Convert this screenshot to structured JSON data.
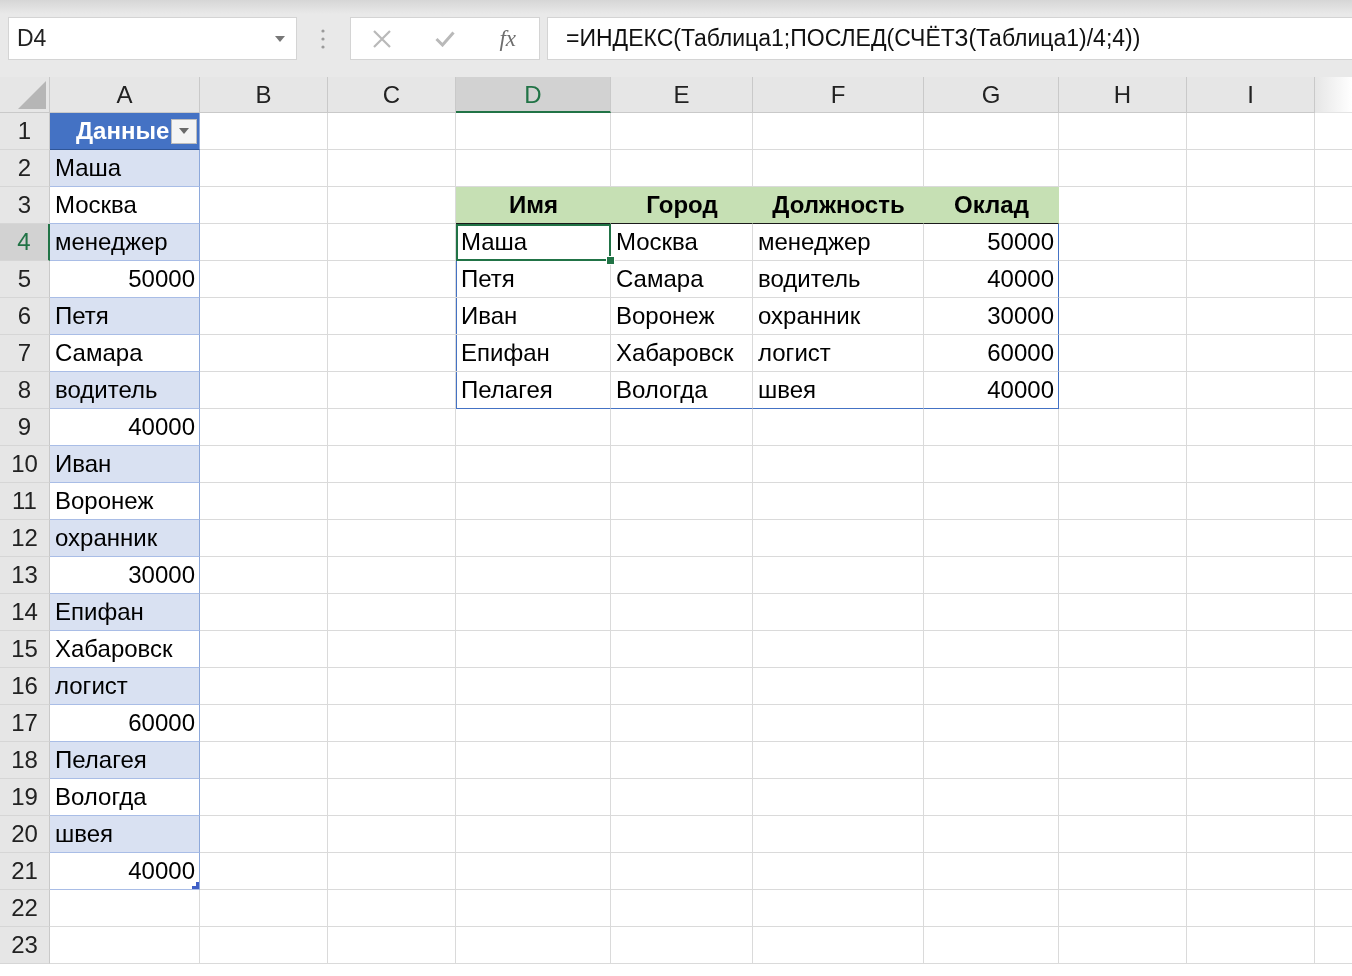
{
  "name_box": {
    "value": "D4"
  },
  "formula_bar": {
    "buttons": [
      {
        "kind": "cancel",
        "disabled": true
      },
      {
        "kind": "enter",
        "disabled": true
      },
      {
        "kind": "function",
        "label": "fx",
        "disabled": false
      }
    ],
    "value": "=ИНДЕКС(Таблица1;ПОСЛЕД(СЧЁТЗ(Таблица1)/4;4))"
  },
  "columns": [
    {
      "label": "A",
      "selected": false
    },
    {
      "label": "B",
      "selected": false
    },
    {
      "label": "C",
      "selected": false
    },
    {
      "label": "D",
      "selected": true
    },
    {
      "label": "E",
      "selected": false
    },
    {
      "label": "F",
      "selected": false
    },
    {
      "label": "G",
      "selected": false
    },
    {
      "label": "H",
      "selected": false
    },
    {
      "label": "I",
      "selected": false
    }
  ],
  "rows": [
    {
      "label": "1",
      "selected": false
    },
    {
      "label": "2",
      "selected": false
    },
    {
      "label": "3",
      "selected": false
    },
    {
      "label": "4",
      "selected": true
    },
    {
      "label": "5",
      "selected": false
    },
    {
      "label": "6",
      "selected": false
    },
    {
      "label": "7",
      "selected": false
    },
    {
      "label": "8",
      "selected": false
    },
    {
      "label": "9",
      "selected": false
    },
    {
      "label": "10",
      "selected": false
    },
    {
      "label": "11",
      "selected": false
    },
    {
      "label": "12",
      "selected": false
    },
    {
      "label": "13",
      "selected": false
    },
    {
      "label": "14",
      "selected": false
    },
    {
      "label": "15",
      "selected": false
    },
    {
      "label": "16",
      "selected": false
    },
    {
      "label": "17",
      "selected": false
    },
    {
      "label": "18",
      "selected": false
    },
    {
      "label": "19",
      "selected": false
    },
    {
      "label": "20",
      "selected": false
    },
    {
      "label": "21",
      "selected": false
    },
    {
      "label": "22",
      "selected": false
    },
    {
      "label": "23",
      "selected": false
    }
  ],
  "data_table": {
    "header": "Данные",
    "cells": [
      {
        "text": "Маша",
        "kind": "text",
        "selected": false
      },
      {
        "text": "Москва",
        "kind": "text",
        "selected": false
      },
      {
        "text": "менеджер",
        "kind": "text",
        "selected": false
      },
      {
        "text": "50000",
        "kind": "number",
        "selected": false
      },
      {
        "text": "Петя",
        "kind": "text",
        "selected": false
      },
      {
        "text": "Самара",
        "kind": "text",
        "selected": false
      },
      {
        "text": "водитель",
        "kind": "text",
        "selected": false
      },
      {
        "text": "40000",
        "kind": "number",
        "selected": false
      },
      {
        "text": "Иван",
        "kind": "text",
        "selected": false
      },
      {
        "text": "Воронеж",
        "kind": "text",
        "selected": false
      },
      {
        "text": "охранник",
        "kind": "text",
        "selected": false
      },
      {
        "text": "30000",
        "kind": "number",
        "selected": false
      },
      {
        "text": "Епифан",
        "kind": "text",
        "selected": false
      },
      {
        "text": "Хабаровск",
        "kind": "text",
        "selected": false
      },
      {
        "text": "логист",
        "kind": "text",
        "selected": false
      },
      {
        "text": "60000",
        "kind": "number",
        "selected": false
      },
      {
        "text": "Пелагея",
        "kind": "text",
        "selected": false
      },
      {
        "text": "Вологда",
        "kind": "text",
        "selected": false
      },
      {
        "text": "швея",
        "kind": "text",
        "selected": false
      },
      {
        "text": "40000",
        "kind": "number",
        "selected": false
      }
    ]
  },
  "result_table": {
    "columns": [
      {
        "label": "Имя",
        "kind": "text"
      },
      {
        "label": "Город",
        "kind": "text"
      },
      {
        "label": "Должность",
        "kind": "text"
      },
      {
        "label": "Оклад",
        "kind": "number"
      }
    ],
    "rows": [
      {
        "cells": [
          {
            "text": "Маша",
            "selected": true
          },
          {
            "text": "Москва",
            "selected": false
          },
          {
            "text": "менеджер",
            "selected": false
          },
          {
            "text": "50000",
            "selected": false
          }
        ]
      },
      {
        "cells": [
          {
            "text": "Петя",
            "selected": false
          },
          {
            "text": "Самара",
            "selected": false
          },
          {
            "text": "водитель",
            "selected": false
          },
          {
            "text": "40000",
            "selected": false
          }
        ]
      },
      {
        "cells": [
          {
            "text": "Иван",
            "selected": false
          },
          {
            "text": "Воронеж",
            "selected": false
          },
          {
            "text": "охранник",
            "selected": false
          },
          {
            "text": "30000",
            "selected": false
          }
        ]
      },
      {
        "cells": [
          {
            "text": "Епифан",
            "selected": false
          },
          {
            "text": "Хабаровск",
            "selected": false
          },
          {
            "text": "логист",
            "selected": false
          },
          {
            "text": "60000",
            "selected": false
          }
        ]
      },
      {
        "cells": [
          {
            "text": "Пелагея",
            "selected": false
          },
          {
            "text": "Вологда",
            "selected": false
          },
          {
            "text": "швея",
            "selected": false
          },
          {
            "text": "40000",
            "selected": false
          }
        ]
      }
    ]
  }
}
